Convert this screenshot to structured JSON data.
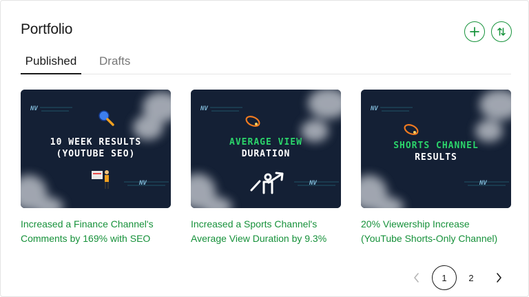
{
  "header": {
    "title": "Portfolio",
    "add_icon": "plus-icon",
    "sort_icon": "sort-arrows-icon",
    "accent_color": "#15923a"
  },
  "tabs": [
    {
      "label": "Published",
      "active": true
    },
    {
      "label": "Drafts",
      "active": false
    }
  ],
  "cards": [
    {
      "thumb_lines": [
        "10 WEEK RESULTS",
        "(YOUTUBE SEO)"
      ],
      "thumb_icon": "magnifier-icon",
      "title": "Increased a Finance Channel's Comments by 169% with SEO"
    },
    {
      "thumb_lines": [
        "AVERAGE VIEW",
        "DURATION"
      ],
      "thumb_icon": "growth-arrow-icon",
      "title": "Increased a Sports Channel's Average View Duration by 9.3%"
    },
    {
      "thumb_lines": [
        "SHORTS CHANNEL",
        "RESULTS"
      ],
      "thumb_icon": "rocket-icon",
      "title": "20% Viewership Increase (YouTube Shorts-Only Channel)"
    }
  ],
  "pagination": {
    "pages": [
      "1",
      "2"
    ],
    "current": "1"
  }
}
